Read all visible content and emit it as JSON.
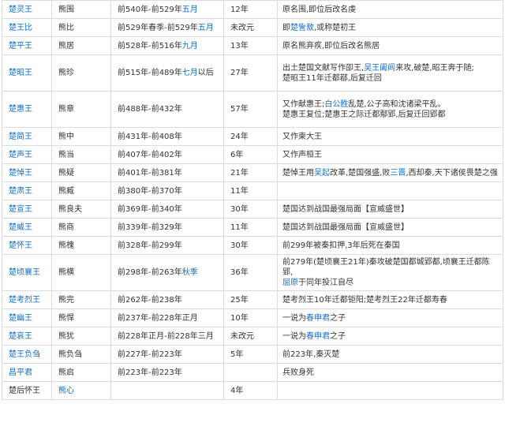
{
  "link_color": "#136ec2",
  "rows": [
    {
      "king": "楚灵王",
      "king_link": true,
      "name": "熊围",
      "reign": [
        "前540年-前529年",
        "五月"
      ],
      "years": "12年",
      "notes": [
        [
          "原名围,即位后改名虔"
        ]
      ]
    },
    {
      "king": "楚王比",
      "king_link": true,
      "name": "熊比",
      "reign": [
        "前529年春季-前529年",
        "五月"
      ],
      "years": "未改元",
      "notes": [
        [
          "即"
        ],
        [
          "楚訾敖",
          "link"
        ],
        [
          ",或称楚初王"
        ]
      ]
    },
    {
      "king": "楚平王",
      "king_link": true,
      "name": "熊居",
      "reign": [
        "前528年-前516年",
        "九月"
      ],
      "years": "13年",
      "notes": [
        [
          "原名熊弃疾,即位后改名熊居"
        ]
      ]
    },
    {
      "king": "楚昭王",
      "king_link": true,
      "name": "熊珍",
      "reign": [
        "前515年-前489年",
        "七月",
        "以后"
      ],
      "years": "27年",
      "notes_lines": [
        [
          [
            "出土楚国文献写作卲王,"
          ],
          [
            "吴王阖闾",
            "link"
          ],
          [
            "来攻,破楚,昭王奔于随;"
          ]
        ],
        [
          [
            "楚昭王11年迁都鄀,后复迁回"
          ]
        ]
      ]
    },
    {
      "king": "楚惠王",
      "king_link": true,
      "name": "熊章",
      "reign": [
        "前488年-前432年"
      ],
      "years": "57年",
      "notes_lines": [
        [
          [
            "又作献惠王;"
          ],
          [
            "白公胜",
            "link"
          ],
          [
            "乱楚,公子高和沈诸梁平乱。"
          ]
        ],
        [
          [
            "楚惠王复位;楚惠王之际迁都鄢郢,后复迁回郢都"
          ]
        ]
      ]
    },
    {
      "king": "楚简王",
      "king_link": true,
      "name": "熊中",
      "reign": [
        "前431年-前408年"
      ],
      "years": "24年",
      "notes": [
        [
          "又作柬大王"
        ]
      ]
    },
    {
      "king": "楚声王",
      "king_link": true,
      "name": "熊当",
      "reign": [
        "前407年-前402年"
      ],
      "years": "6年",
      "notes": [
        [
          "又作声桓王"
        ]
      ]
    },
    {
      "king": "楚悼王",
      "king_link": true,
      "name": "熊疑",
      "reign": [
        "前401年-前381年"
      ],
      "years": "21年",
      "notes": [
        [
          "楚悼王用"
        ],
        [
          "吴起",
          "link"
        ],
        [
          "改革,楚国强盛,败"
        ],
        [
          "三晋",
          "link"
        ],
        [
          ",西却秦,天下诸侯畏楚之强"
        ]
      ]
    },
    {
      "king": "楚肃王",
      "king_link": true,
      "name": "熊臧",
      "reign": [
        "前380年-前370年"
      ],
      "years": "11年",
      "notes": []
    },
    {
      "king": "楚宣王",
      "king_link": true,
      "name": "熊良夫",
      "reign": [
        "前369年-前340年"
      ],
      "years": "30年",
      "notes": [
        [
          "楚国达到战国最强局面【宣威盛世】"
        ]
      ]
    },
    {
      "king": "楚威王",
      "king_link": true,
      "name": "熊商",
      "reign": [
        "前339年-前329年"
      ],
      "years": "11年",
      "notes": [
        [
          "楚国达到战国最强局面【宣威盛世】"
        ]
      ]
    },
    {
      "king": "楚怀王",
      "king_link": true,
      "name": "熊槐",
      "reign": [
        "前328年-前299年"
      ],
      "years": "30年",
      "notes": [
        [
          "前299年被秦扣押,3年后死在秦国"
        ]
      ]
    },
    {
      "king": "楚顷襄王",
      "king_link": true,
      "name": "熊横",
      "reign": [
        "前298年-前263年",
        "秋季"
      ],
      "years": "36年",
      "notes_lines": [
        [
          [
            "前279年(楚顷襄王21年)秦攻破楚国都城郢都,顷襄王迁都陈郢,"
          ]
        ],
        [
          [
            "屈原",
            "link"
          ],
          [
            "于同年投江自尽"
          ]
        ]
      ]
    },
    {
      "king": "楚考烈王",
      "king_link": true,
      "name": "熊完",
      "reign": [
        "前262年-前238年"
      ],
      "years": "25年",
      "notes": [
        [
          "楚考烈王10年迁都钜阳;楚考烈王22年迁都寿春"
        ]
      ]
    },
    {
      "king": "楚幽王",
      "king_link": true,
      "name": "熊悍",
      "reign": [
        "前237年-前228年正月"
      ],
      "years": "10年",
      "notes": [
        [
          "一说为"
        ],
        [
          "春申君",
          "link"
        ],
        [
          "之子"
        ]
      ]
    },
    {
      "king": "楚哀王",
      "king_link": true,
      "name": "熊犹",
      "reign": [
        "前228年正月-前228年三月"
      ],
      "years": "未改元",
      "notes": [
        [
          "一说为"
        ],
        [
          "春申君",
          "link"
        ],
        [
          "之子"
        ]
      ]
    },
    {
      "king": "楚王负刍",
      "king_link": true,
      "name": "熊负刍",
      "reign": [
        "前227年-前223年"
      ],
      "years": "5年",
      "notes": [
        [
          "前223年,秦灭楚"
        ]
      ]
    },
    {
      "king": "昌平君",
      "king_link": true,
      "name": "熊启",
      "reign": [
        "前223年-前223年"
      ],
      "years": "",
      "notes": [
        [
          "兵败身死"
        ]
      ]
    },
    {
      "king": "楚后怀王",
      "king_link": false,
      "name": "熊心",
      "name_link": true,
      "reign": [
        ""
      ],
      "years": "4年",
      "notes": []
    }
  ]
}
